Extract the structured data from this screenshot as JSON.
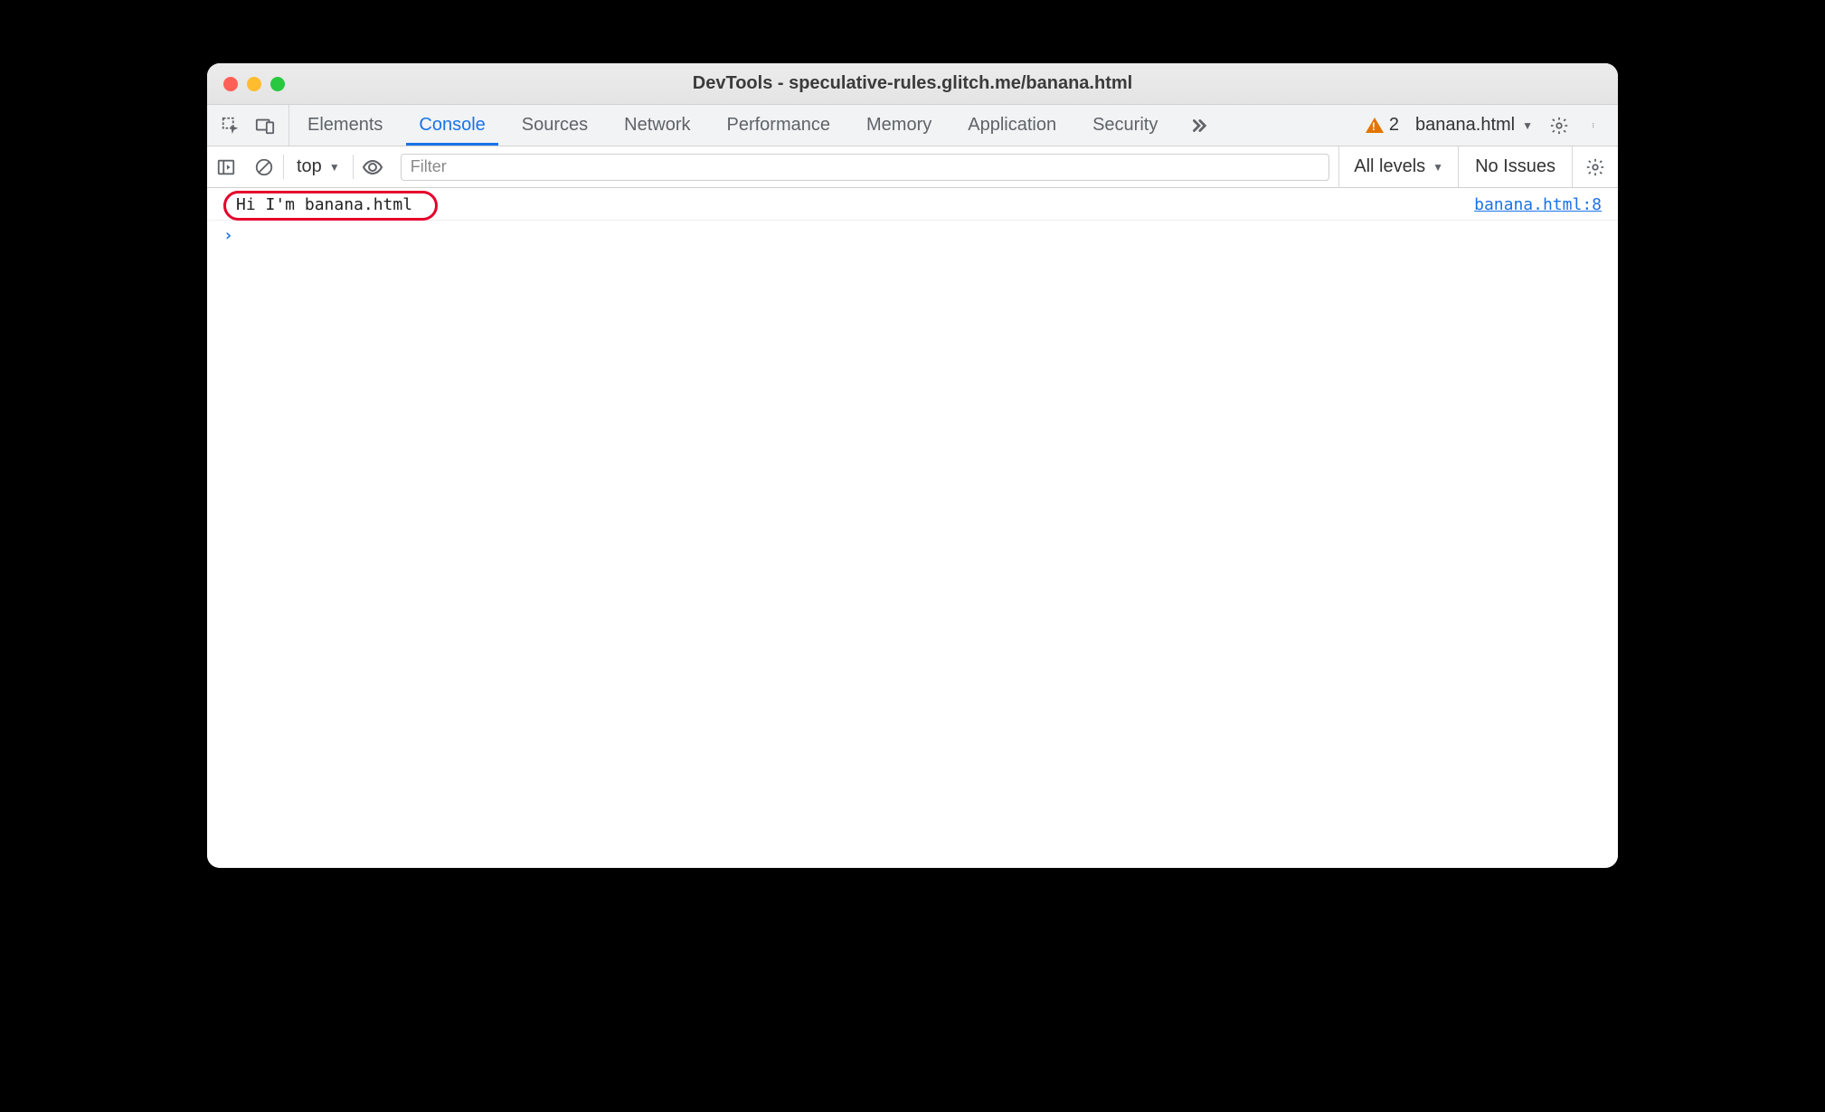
{
  "window": {
    "title": "DevTools - speculative-rules.glitch.me/banana.html"
  },
  "tabs": {
    "items": [
      "Elements",
      "Console",
      "Sources",
      "Network",
      "Performance",
      "Memory",
      "Application",
      "Security"
    ],
    "active_index": 1,
    "warnings_count": "2",
    "target_label": "banana.html"
  },
  "console_toolbar": {
    "context_label": "top",
    "filter_placeholder": "Filter",
    "levels_label": "All levels",
    "issues_label": "No Issues"
  },
  "console": {
    "logs": [
      {
        "message": "Hi I'm banana.html",
        "source": "banana.html:8"
      }
    ]
  }
}
